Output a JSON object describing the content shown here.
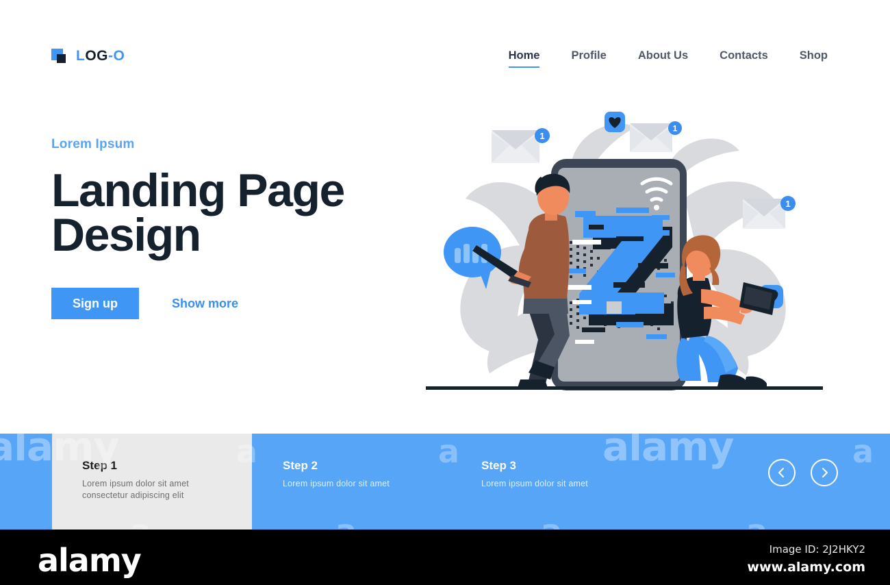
{
  "header": {
    "logo": {
      "text_part1": "L",
      "text_part2": "OG",
      "text_part3": "-O",
      "icon": "logo-square-icon"
    },
    "nav": [
      {
        "label": "Home",
        "active": true
      },
      {
        "label": "Profile",
        "active": false
      },
      {
        "label": "About Us",
        "active": false
      },
      {
        "label": "Contacts",
        "active": false
      },
      {
        "label": "Shop",
        "active": false
      }
    ]
  },
  "hero": {
    "eyebrow": "Lorem Ipsum",
    "headline_line1": "Landing Page",
    "headline_line2": "Design",
    "primary_button": "Sign up",
    "secondary_link": "Show more"
  },
  "illustration": {
    "phone_letter": "Z",
    "wifi_icon": "wifi-icon",
    "badges": [
      "1",
      "1",
      "1"
    ],
    "heart_icon": "heart-icon",
    "speech_bubble_icon": "speech-bubble-icon",
    "envelope_icon": "envelope-icon",
    "person_left": "man-with-laptop",
    "person_right": "woman-with-tablet"
  },
  "steps": [
    {
      "title": "Step 1",
      "desc": "Lorem ipsum dolor sit amet\nconsectetur adipiscing elit",
      "active": true
    },
    {
      "title": "Step 2",
      "desc": "Lorem ipsum dolor sit amet",
      "active": false
    },
    {
      "title": "Step 3",
      "desc": "Lorem ipsum dolor sit amet",
      "active": false
    }
  ],
  "carousel": {
    "prev_icon": "chevron-left-icon",
    "next_icon": "chevron-right-icon"
  },
  "watermark": {
    "text": "alamy"
  },
  "footer": {
    "logo": "alamy",
    "image_id": "Image ID: 2J2HKY2",
    "url": "www.alamy.com"
  },
  "colors": {
    "accent_blue": "#4096f5",
    "band_blue": "#56a5f7",
    "dark_navy": "#16212e",
    "card_gray": "#eaeaea",
    "nav_gray": "#4e5968",
    "footer_black": "#000000"
  }
}
